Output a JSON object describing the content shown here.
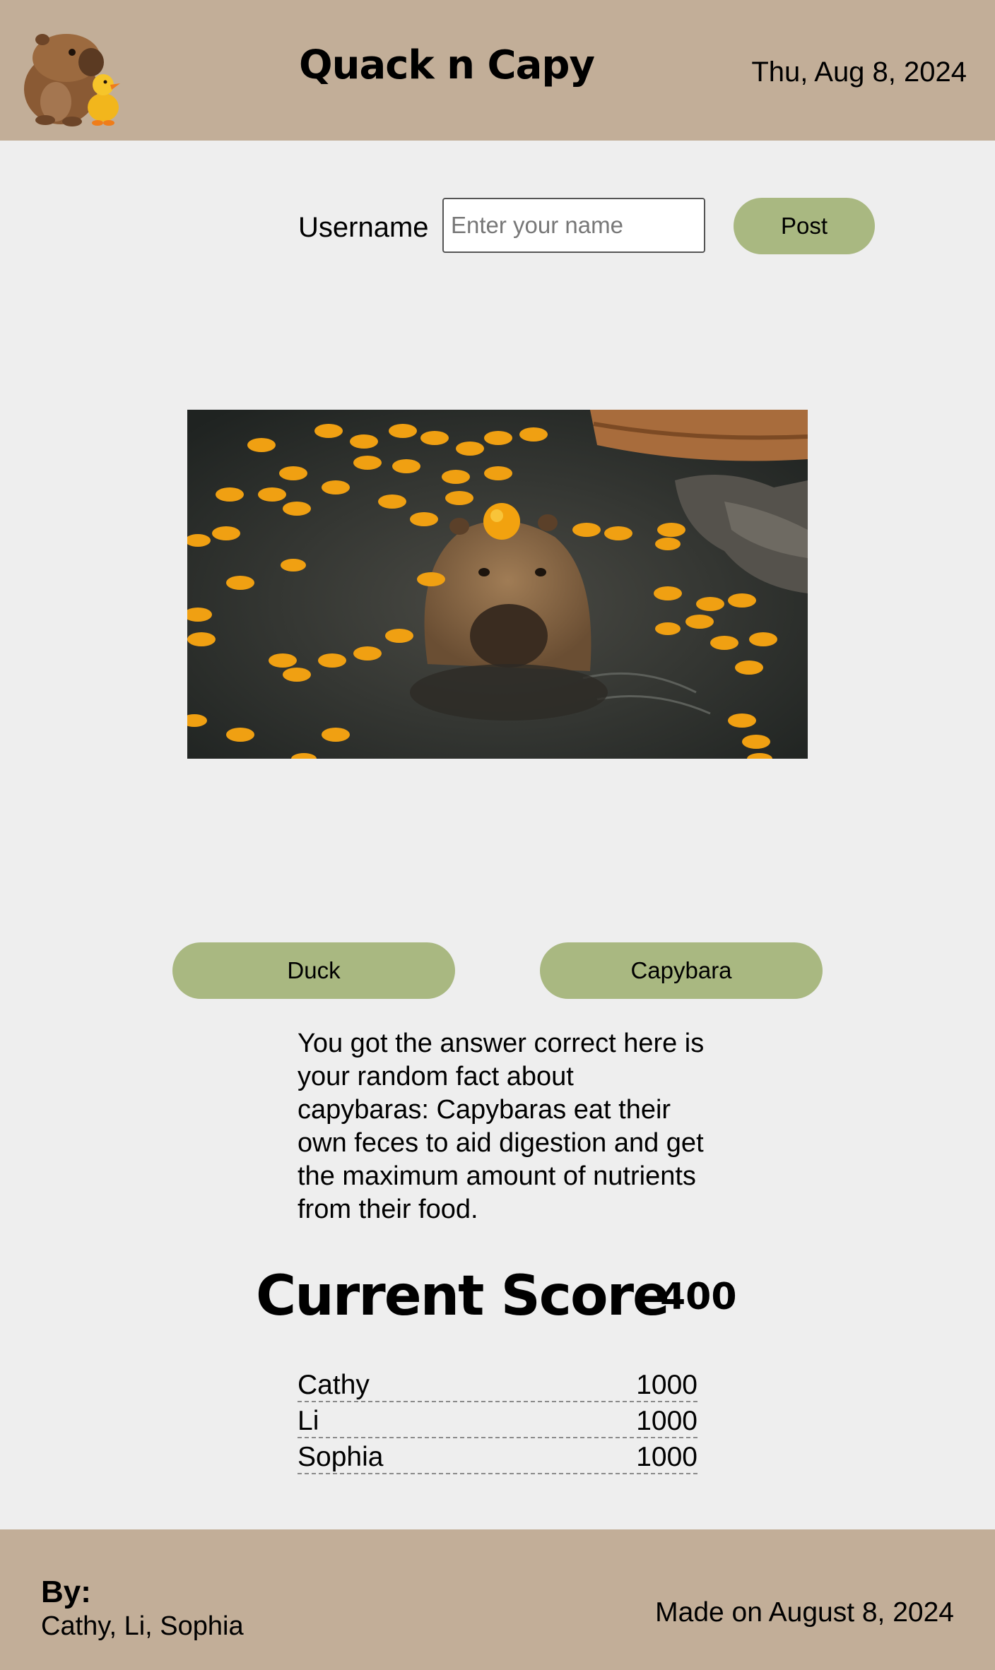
{
  "header": {
    "logo_icon": "capybara-and-duckling-icon",
    "title": "Quack n Capy",
    "date": "Thu, Aug 8, 2024"
  },
  "form": {
    "username_label": "Username",
    "username_placeholder": "Enter your name",
    "username_value": "",
    "post_label": "Post"
  },
  "image": {
    "subject": "capybara-in-pond-with-oranges"
  },
  "choices": {
    "duck_label": "Duck",
    "capybara_label": "Capybara"
  },
  "fact_text": "You got the answer correct here is your random fact about capybaras: Capybaras eat their own feces to aid digestion and get the maximum amount of nutrients from their food.",
  "score": {
    "label": "Current Score",
    "value": "400"
  },
  "leaderboard": [
    {
      "name": "Cathy",
      "score": "1000"
    },
    {
      "name": "Li",
      "score": "1000"
    },
    {
      "name": "Sophia",
      "score": "1000"
    }
  ],
  "footer": {
    "by_label": "By:",
    "authors": "Cathy, Li, Sophia",
    "made_on": "Made on August 8, 2024"
  },
  "colors": {
    "header_bg": "#c2ae98",
    "page_bg": "#eeeeee",
    "button_bg": "#a9b881"
  }
}
